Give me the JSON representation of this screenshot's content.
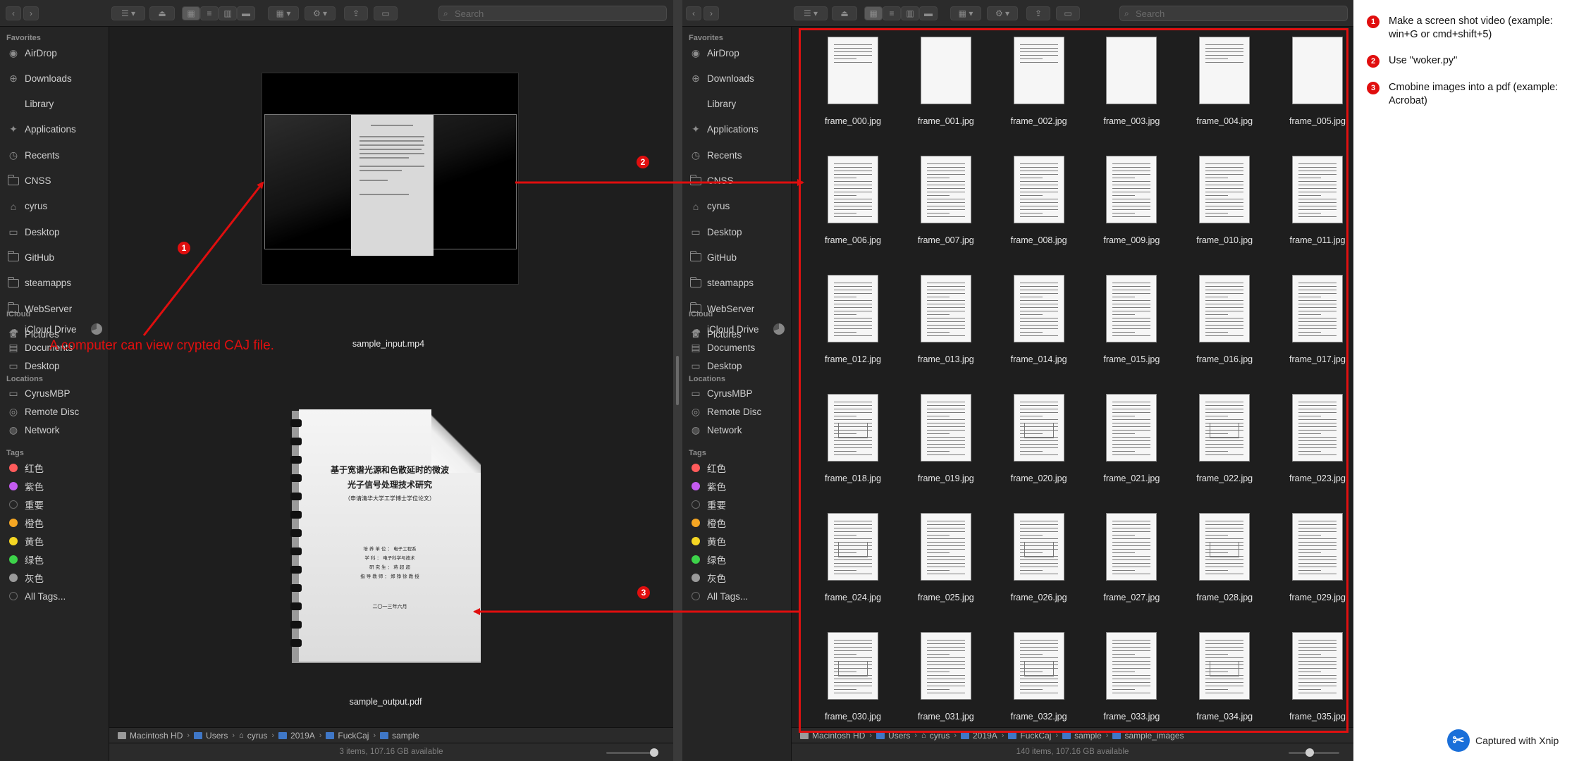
{
  "search_placeholder": "Search",
  "sidebar": {
    "favorites_header": "Favorites",
    "favorites": [
      "AirDrop",
      "Downloads",
      "Library",
      "Applications",
      "Recents",
      "CNSS",
      "cyrus",
      "Desktop",
      "GitHub",
      "steamapps",
      "WebServer",
      "Pictures"
    ],
    "icloud_header": "iCloud",
    "icloud": [
      "iCloud Drive",
      "Documents",
      "Desktop"
    ],
    "locations_header": "Locations",
    "locations": [
      "CyrusMBP",
      "Remote Disc",
      "Network"
    ],
    "tags_header": "Tags",
    "tags": [
      {
        "label": "红色",
        "color": "#ff5b5b"
      },
      {
        "label": "紫色",
        "color": "#c45bf0"
      },
      {
        "label": "重要",
        "color": ""
      },
      {
        "label": "橙色",
        "color": "#f5a623"
      },
      {
        "label": "黄色",
        "color": "#f5d623"
      },
      {
        "label": "绿色",
        "color": "#3dd34a"
      },
      {
        "label": "灰色",
        "color": "#9a9a9a"
      },
      {
        "label": "All Tags...",
        "color": ""
      }
    ]
  },
  "left_window": {
    "files": [
      "sample_input.mp4",
      "sample_output.pdf"
    ],
    "pdf_preview": {
      "title_line1": "基于宽谱光源和色散延时的微波",
      "title_line2": "光子信号处理技术研究",
      "subtitle": "（申请清华大学工学博士学位论文）",
      "fields": [
        "培 养 单 位 ： 电子工程系",
        "学       科 ： 电子科学与技术",
        "研  究  生 ： 蒋 超 超",
        "指 导 教 师 ： 郑 铮 徐 教 授"
      ],
      "date": "二〇一三年六月"
    },
    "path": [
      "Macintosh HD",
      "Users",
      "cyrus",
      "2019A",
      "FuckCaj",
      "sample"
    ],
    "status": "3 items, 107.16 GB available"
  },
  "right_window": {
    "frames": [
      "frame_000.jpg",
      "frame_001.jpg",
      "frame_002.jpg",
      "frame_003.jpg",
      "frame_004.jpg",
      "frame_005.jpg",
      "frame_006.jpg",
      "frame_007.jpg",
      "frame_008.jpg",
      "frame_009.jpg",
      "frame_010.jpg",
      "frame_011.jpg",
      "frame_012.jpg",
      "frame_013.jpg",
      "frame_014.jpg",
      "frame_015.jpg",
      "frame_016.jpg",
      "frame_017.jpg",
      "frame_018.jpg",
      "frame_019.jpg",
      "frame_020.jpg",
      "frame_021.jpg",
      "frame_022.jpg",
      "frame_023.jpg",
      "frame_024.jpg",
      "frame_025.jpg",
      "frame_026.jpg",
      "frame_027.jpg",
      "frame_028.jpg",
      "frame_029.jpg",
      "frame_030.jpg",
      "frame_031.jpg",
      "frame_032.jpg",
      "frame_033.jpg",
      "frame_034.jpg",
      "frame_035.jpg"
    ],
    "path": [
      "Macintosh HD",
      "Users",
      "cyrus",
      "2019A",
      "FuckCaj",
      "sample",
      "sample_images"
    ],
    "status": "140 items, 107.16 GB available"
  },
  "annotations": {
    "arrow1_text": "A computer can view crypted CAJ file.",
    "badges": [
      "1",
      "2",
      "3"
    ],
    "accent_color": "#e00e0e"
  },
  "instructions": {
    "steps": [
      {
        "n": "1",
        "text": "Make a screen shot video (example: win+G or cmd+shift+5)"
      },
      {
        "n": "2",
        "text": "Use \"woker.py\""
      },
      {
        "n": "3",
        "text": "Cmobine images into a pdf (example: Acrobat)"
      }
    ],
    "footer": "Captured with Xnip"
  }
}
